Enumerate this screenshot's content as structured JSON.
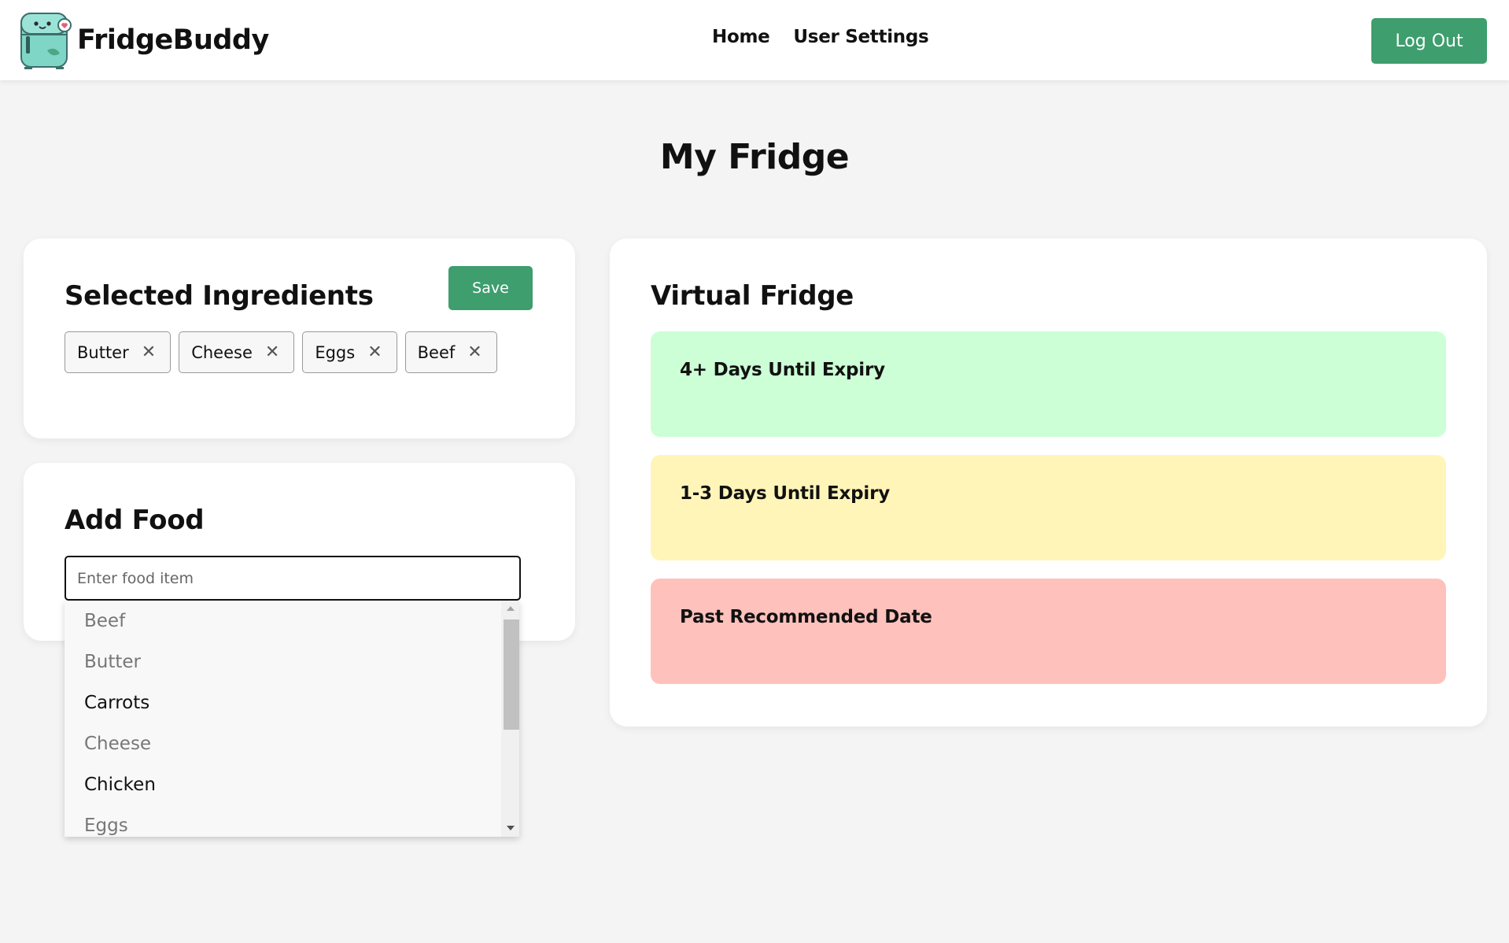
{
  "header": {
    "brand": "FridgeBuddy",
    "logo_icon": "fridge-mascot-icon",
    "nav": [
      {
        "label": "Home"
      },
      {
        "label": "User Settings"
      }
    ],
    "logout_label": "Log Out",
    "accent_color": "#3e9e6e"
  },
  "page": {
    "title": "My Fridge"
  },
  "selected_ingredients": {
    "title": "Selected Ingredients",
    "save_label": "Save",
    "chips": [
      {
        "label": "Butter",
        "remove_icon": "close-icon"
      },
      {
        "label": "Cheese",
        "remove_icon": "close-icon"
      },
      {
        "label": "Eggs",
        "remove_icon": "close-icon"
      },
      {
        "label": "Beef",
        "remove_icon": "close-icon"
      }
    ]
  },
  "add_food": {
    "title": "Add Food",
    "input_value": "",
    "input_placeholder": "Enter food item",
    "dropdown": [
      {
        "label": "Beef",
        "disabled": true
      },
      {
        "label": "Butter",
        "disabled": true
      },
      {
        "label": "Carrots",
        "disabled": false
      },
      {
        "label": "Cheese",
        "disabled": true
      },
      {
        "label": "Chicken",
        "disabled": false
      },
      {
        "label": "Eggs",
        "disabled": true
      }
    ]
  },
  "virtual_fridge": {
    "title": "Virtual Fridge",
    "sections": [
      {
        "label": "4+ Days Until Expiry",
        "color": "#ccffd5"
      },
      {
        "label": "1-3 Days Until Expiry",
        "color": "#fff5b8"
      },
      {
        "label": "Past Recommended Date",
        "color": "#ffc1bc"
      }
    ]
  }
}
